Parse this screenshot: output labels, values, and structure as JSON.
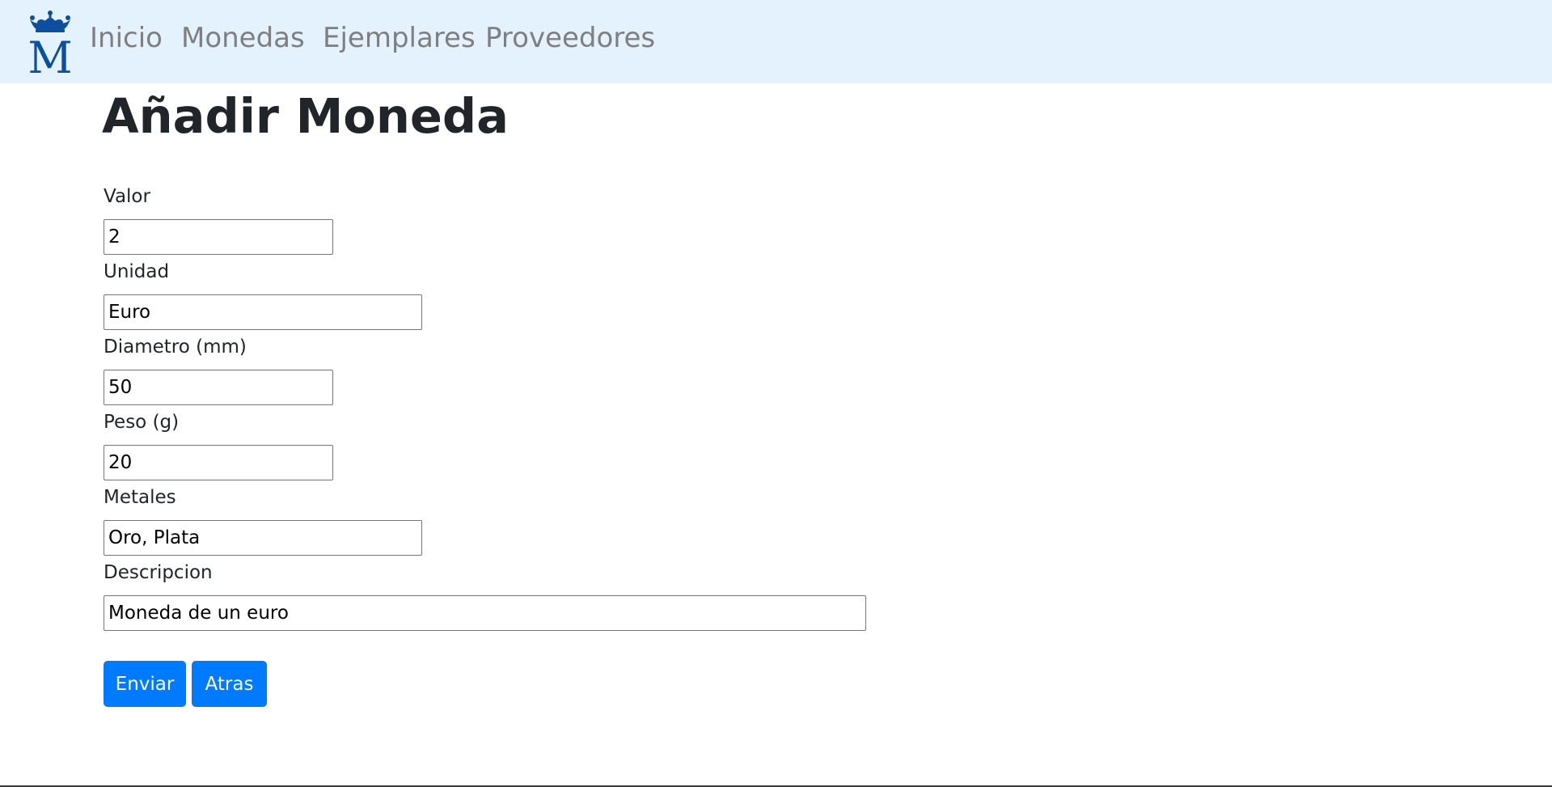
{
  "navbar": {
    "logo_letter": "M",
    "links": [
      "Inicio",
      "Monedas",
      "Ejemplares",
      "Proveedores"
    ]
  },
  "page": {
    "title": "Añadir Moneda"
  },
  "form": {
    "fields": [
      {
        "label": "Valor",
        "value": "2"
      },
      {
        "label": "Unidad",
        "value": "Euro"
      },
      {
        "label": "Diametro (mm)",
        "value": "50"
      },
      {
        "label": "Peso (g)",
        "value": "20"
      },
      {
        "label": "Metales",
        "value": "Oro, Plata"
      },
      {
        "label": "Descripcion",
        "value": "Moneda de un euro"
      }
    ],
    "submit_label": "Enviar",
    "back_label": "Atras"
  },
  "colors": {
    "navbar_bg": "#e3f2fd",
    "logo_blue": "#0d4f9c",
    "button_primary": "#007bff",
    "nav_text": "#7f7f7f"
  }
}
